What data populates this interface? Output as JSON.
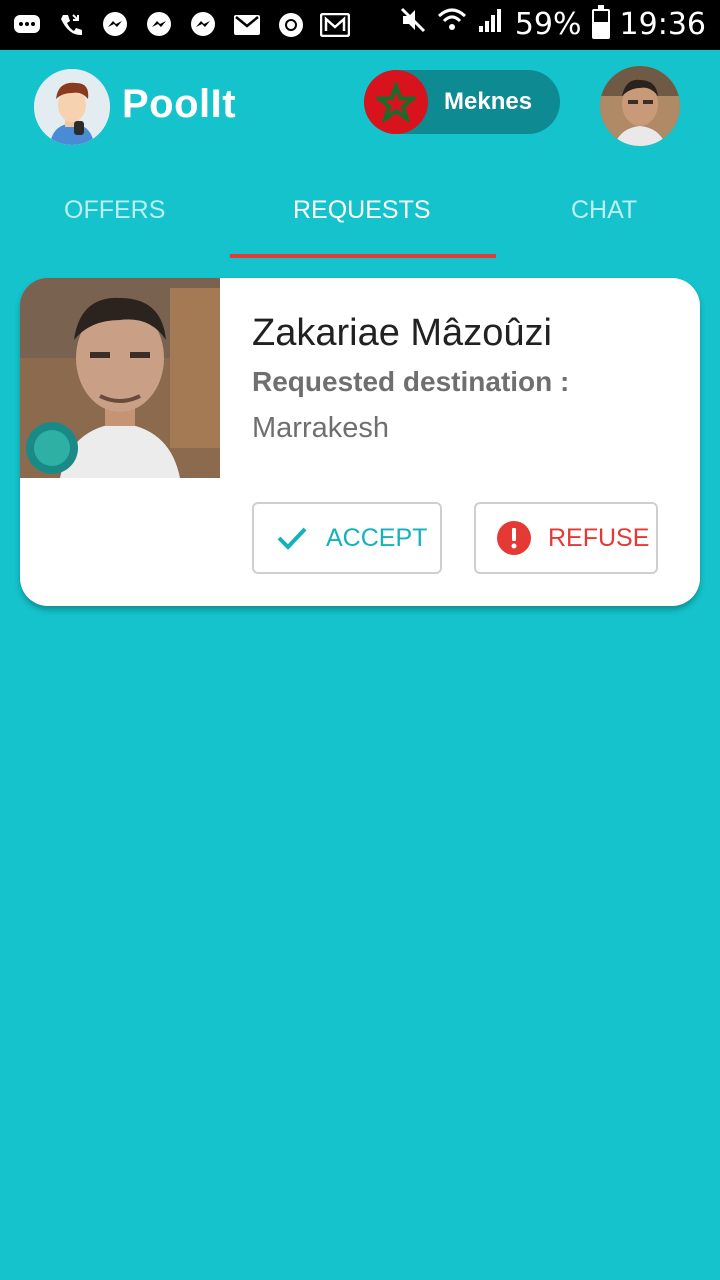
{
  "status_bar": {
    "battery_percent": "59%",
    "battery_level": 0.59,
    "time": "19:36",
    "icons": [
      "messages-icon",
      "missed-call-icon",
      "messenger-icon",
      "messenger-icon",
      "messenger-icon",
      "gmail-icon",
      "chrome-icon",
      "email-icon",
      "mute-icon",
      "wifi-icon",
      "signal-icon"
    ]
  },
  "app": {
    "title": "PoolIt",
    "city": "Meknes",
    "flag_icon": "morocco-flag-icon"
  },
  "tabs": [
    {
      "label": "OFFERS",
      "active": false
    },
    {
      "label": "REQUESTS",
      "active": true
    },
    {
      "label": "CHAT",
      "active": false
    }
  ],
  "request_card": {
    "name": "Zakariae Mâzoûzi",
    "destination_label": "Requested destination :",
    "destination": "Marrakesh",
    "accept_label": "ACCEPT",
    "refuse_label": "REFUSE"
  },
  "colors": {
    "background": "#14c3cc",
    "accent_red": "#e53935",
    "pill": "#0e8a93"
  }
}
